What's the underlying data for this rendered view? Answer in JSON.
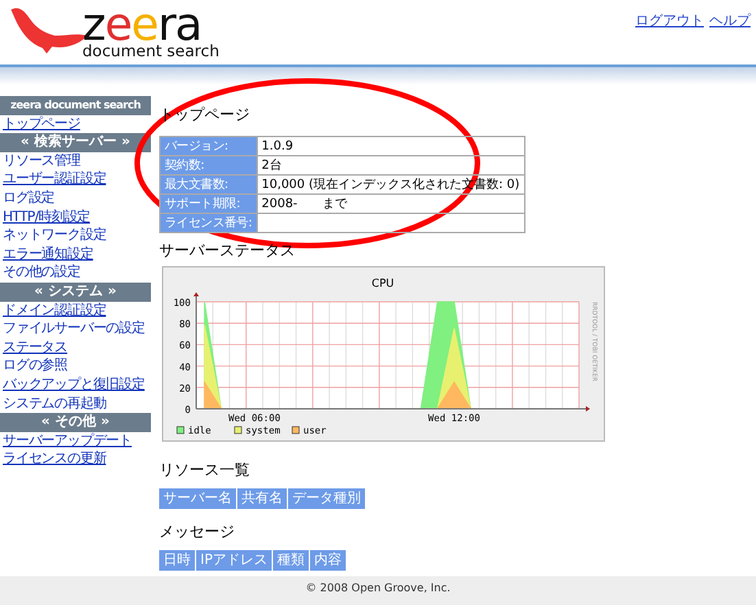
{
  "header": {
    "logo_letters": [
      {
        "text": "z",
        "color": "#111111"
      },
      {
        "text": "e",
        "color": "#e03030"
      },
      {
        "text": "e",
        "color": "#f5b000"
      },
      {
        "text": "ra",
        "color": "#111111"
      }
    ],
    "logo_tagline": "document search",
    "links": [
      "ログアウト",
      "ヘルプ"
    ]
  },
  "sidebar": {
    "title": "zeera document search",
    "items": [
      {
        "kind": "link",
        "label": "トップページ",
        "underlined": true
      },
      {
        "kind": "section",
        "label": "« 検索サーバー »"
      },
      {
        "kind": "link",
        "label": "リソース管理",
        "underlined": false
      },
      {
        "kind": "link",
        "label": "ユーザー認証設定",
        "underlined": true
      },
      {
        "kind": "link",
        "label": "ログ設定",
        "underlined": false
      },
      {
        "kind": "link",
        "label": "HTTP/時刻設定",
        "underlined": true
      },
      {
        "kind": "link",
        "label": "ネットワーク設定",
        "underlined": false
      },
      {
        "kind": "link",
        "label": "エラー通知設定",
        "underlined": true
      },
      {
        "kind": "link",
        "label": "その他の設定",
        "underlined": false
      },
      {
        "kind": "section",
        "label": "« システム »"
      },
      {
        "kind": "link",
        "label": "ドメイン認証設定",
        "underlined": true
      },
      {
        "kind": "link",
        "label": "ファイルサーバーの設定",
        "underlined": false
      },
      {
        "kind": "link",
        "label": "ステータス",
        "underlined": true
      },
      {
        "kind": "link",
        "label": "ログの参照",
        "underlined": false
      },
      {
        "kind": "link",
        "label": "バックアップと復旧設定",
        "underlined": true
      },
      {
        "kind": "link",
        "label": "システムの再起動",
        "underlined": false
      },
      {
        "kind": "section",
        "label": "« その他 »"
      },
      {
        "kind": "link",
        "label": "サーバーアップデート",
        "underlined": true
      },
      {
        "kind": "link",
        "label": "ライセンスの更新",
        "underlined": true
      }
    ]
  },
  "main": {
    "title": "トップページ",
    "info_rows": [
      {
        "label": "バージョン:",
        "value": "1.0.9"
      },
      {
        "label": "契約数:",
        "value": "2台"
      },
      {
        "label": "最大文書数:",
        "value": "10,000 (現在インデックス化された文書数: 0)"
      },
      {
        "label": "サポート期限:",
        "value": "2008-　　まで"
      },
      {
        "label": "ライセンス番号:"
      }
    ],
    "status_title": "サーバーステータス",
    "chart": {
      "credit": "RRDTOOL / TOBI OETIKER",
      "chart_data": {
        "type": "area",
        "title": "CPU",
        "categories": [
          null,
          null,
          null,
          "Wed 06:00",
          null,
          null,
          null,
          null,
          null,
          null,
          null,
          null,
          null,
          null,
          null,
          "Wed 12:00",
          null,
          null,
          null,
          null,
          null,
          null,
          null
        ],
        "series": [
          {
            "name": "idle",
            "color": "#80f080",
            "values": [
              100,
              0,
              0,
              0,
              0,
              0,
              0,
              0,
              0,
              0,
              0,
              0,
              0,
              0,
              100,
              100,
              0,
              0,
              0,
              0,
              0,
              0,
              0
            ]
          },
          {
            "name": "system",
            "color": "#e8f070",
            "values": [
              78,
              0,
              0,
              0,
              0,
              0,
              0,
              0,
              0,
              0,
              0,
              0,
              0,
              0,
              0,
              75,
              0,
              0,
              0,
              0,
              0,
              0,
              0
            ]
          },
          {
            "name": "user",
            "color": "#ffb860",
            "values": [
              25,
              0,
              0,
              0,
              0,
              0,
              0,
              0,
              0,
              0,
              0,
              0,
              0,
              0,
              0,
              25,
              0,
              0,
              0,
              0,
              0,
              0,
              0
            ]
          }
        ],
        "ylim": [
          0,
          100
        ],
        "yticks": [
          0,
          20,
          40,
          60,
          80,
          100
        ],
        "grid": true,
        "legend": "bottom"
      }
    },
    "resources_title": "リソース一覧",
    "resource_columns": [
      "サーバー名",
      "共有名",
      "データ種別"
    ],
    "messages_title": "メッセージ",
    "message_columns": [
      "日時",
      "IPアドレス",
      "種類",
      "内容"
    ],
    "annotation": {
      "kind": "ellipse"
    }
  },
  "footer": {
    "text": "© 2008 Open Groove, Inc."
  }
}
